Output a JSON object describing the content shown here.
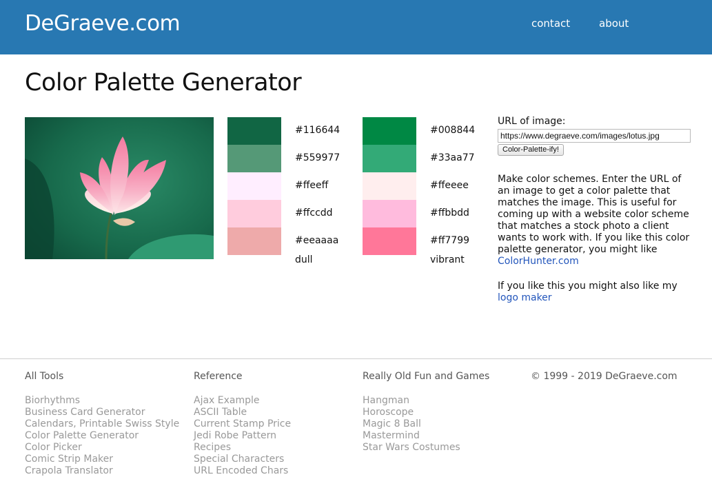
{
  "header": {
    "logo": "DeGraeve.com",
    "nav": [
      "contact",
      "about"
    ]
  },
  "page_title": "Color Palette Generator",
  "palettes": {
    "dull": {
      "label": "dull",
      "colors": [
        "#116644",
        "#559977",
        "#ffeeff",
        "#ffccdd",
        "#eeaaaa"
      ]
    },
    "vibrant": {
      "label": "vibrant",
      "colors": [
        "#008844",
        "#33aa77",
        "#ffeeee",
        "#ffbbdd",
        "#ff7799"
      ]
    }
  },
  "form": {
    "label": "URL of image:",
    "url_value": "https://www.degraeve.com/images/lotus.jpg",
    "button": "Color-Palette-ify!"
  },
  "description": {
    "text": "Make color schemes. Enter the URL of an image to get a color palette that matches the image. This is useful for coming up with a website color scheme that matches a stock photo a client wants to work with. If you like this color palette generator, you might like",
    "link": "ColorHunter.com",
    "also_text": "If you like this you might also like my",
    "also_link": "logo maker"
  },
  "footer": {
    "columns": [
      {
        "heading": "All Tools",
        "links": [
          "Biorhythms",
          "Business Card Generator",
          "Calendars, Printable Swiss Style",
          "Color Palette Generator",
          "Color Picker",
          "Comic Strip Maker",
          "Crapola Translator"
        ]
      },
      {
        "heading": "Reference",
        "links": [
          "Ajax Example",
          "ASCII Table",
          "Current Stamp Price",
          "Jedi Robe Pattern",
          "Recipes",
          "Special Characters",
          "URL Encoded Chars"
        ]
      },
      {
        "heading": "Really Old Fun and Games",
        "links": [
          "Hangman",
          "Horoscope",
          "Magic 8 Ball",
          "Mastermind",
          "Star Wars Costumes"
        ]
      }
    ],
    "copyright": "© 1999 - 2019 DeGraeve.com"
  }
}
